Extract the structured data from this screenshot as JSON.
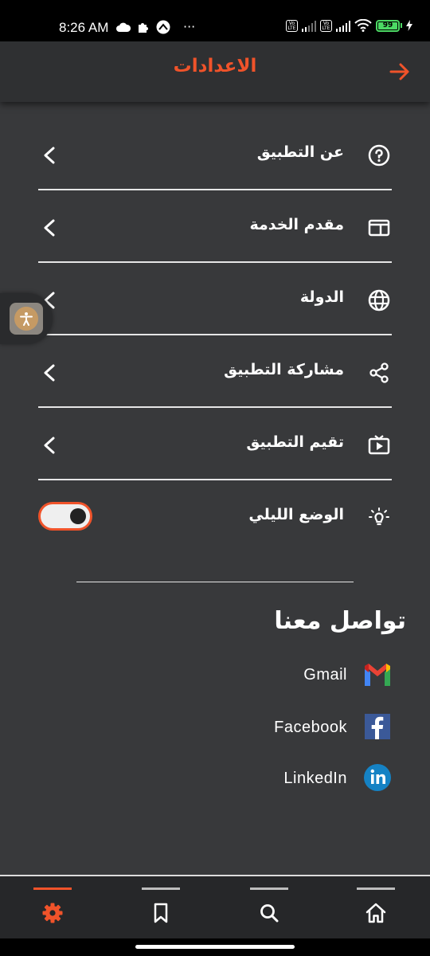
{
  "status_bar": {
    "time": "8:26 AM",
    "dots": "···",
    "volte_1": "Vo LTE",
    "volte_2": "Vo LTE",
    "battery": "99"
  },
  "header": {
    "title": "الاعدادات",
    "back_icon": "arrow-right-icon",
    "accent_color": "#f0532a"
  },
  "settings": {
    "items": [
      {
        "label": "عن التطبيق",
        "icon": "help-circle-icon"
      },
      {
        "label": "مقدم الخدمة",
        "icon": "window-icon"
      },
      {
        "label": "الدولة",
        "icon": "globe-icon"
      },
      {
        "label": "مشاركة التطبيق",
        "icon": "share-icon"
      },
      {
        "label": "تقيم التطبيق",
        "icon": "video-play-icon"
      }
    ],
    "dark_mode": {
      "label": "الوضع الليلي",
      "icon": "lightbulb-icon",
      "enabled": true
    }
  },
  "contact": {
    "title": "تواصل معنا",
    "links": [
      {
        "label": "Gmail",
        "icon": "gmail-icon"
      },
      {
        "label": "Facebook",
        "icon": "facebook-icon"
      },
      {
        "label": "LinkedIn",
        "icon": "linkedin-icon"
      }
    ]
  },
  "bottom_nav": {
    "items": [
      {
        "icon": "gear-icon",
        "active": true
      },
      {
        "icon": "bookmark-icon",
        "active": false
      },
      {
        "icon": "search-icon",
        "active": false
      },
      {
        "icon": "home-icon",
        "active": false
      }
    ]
  }
}
